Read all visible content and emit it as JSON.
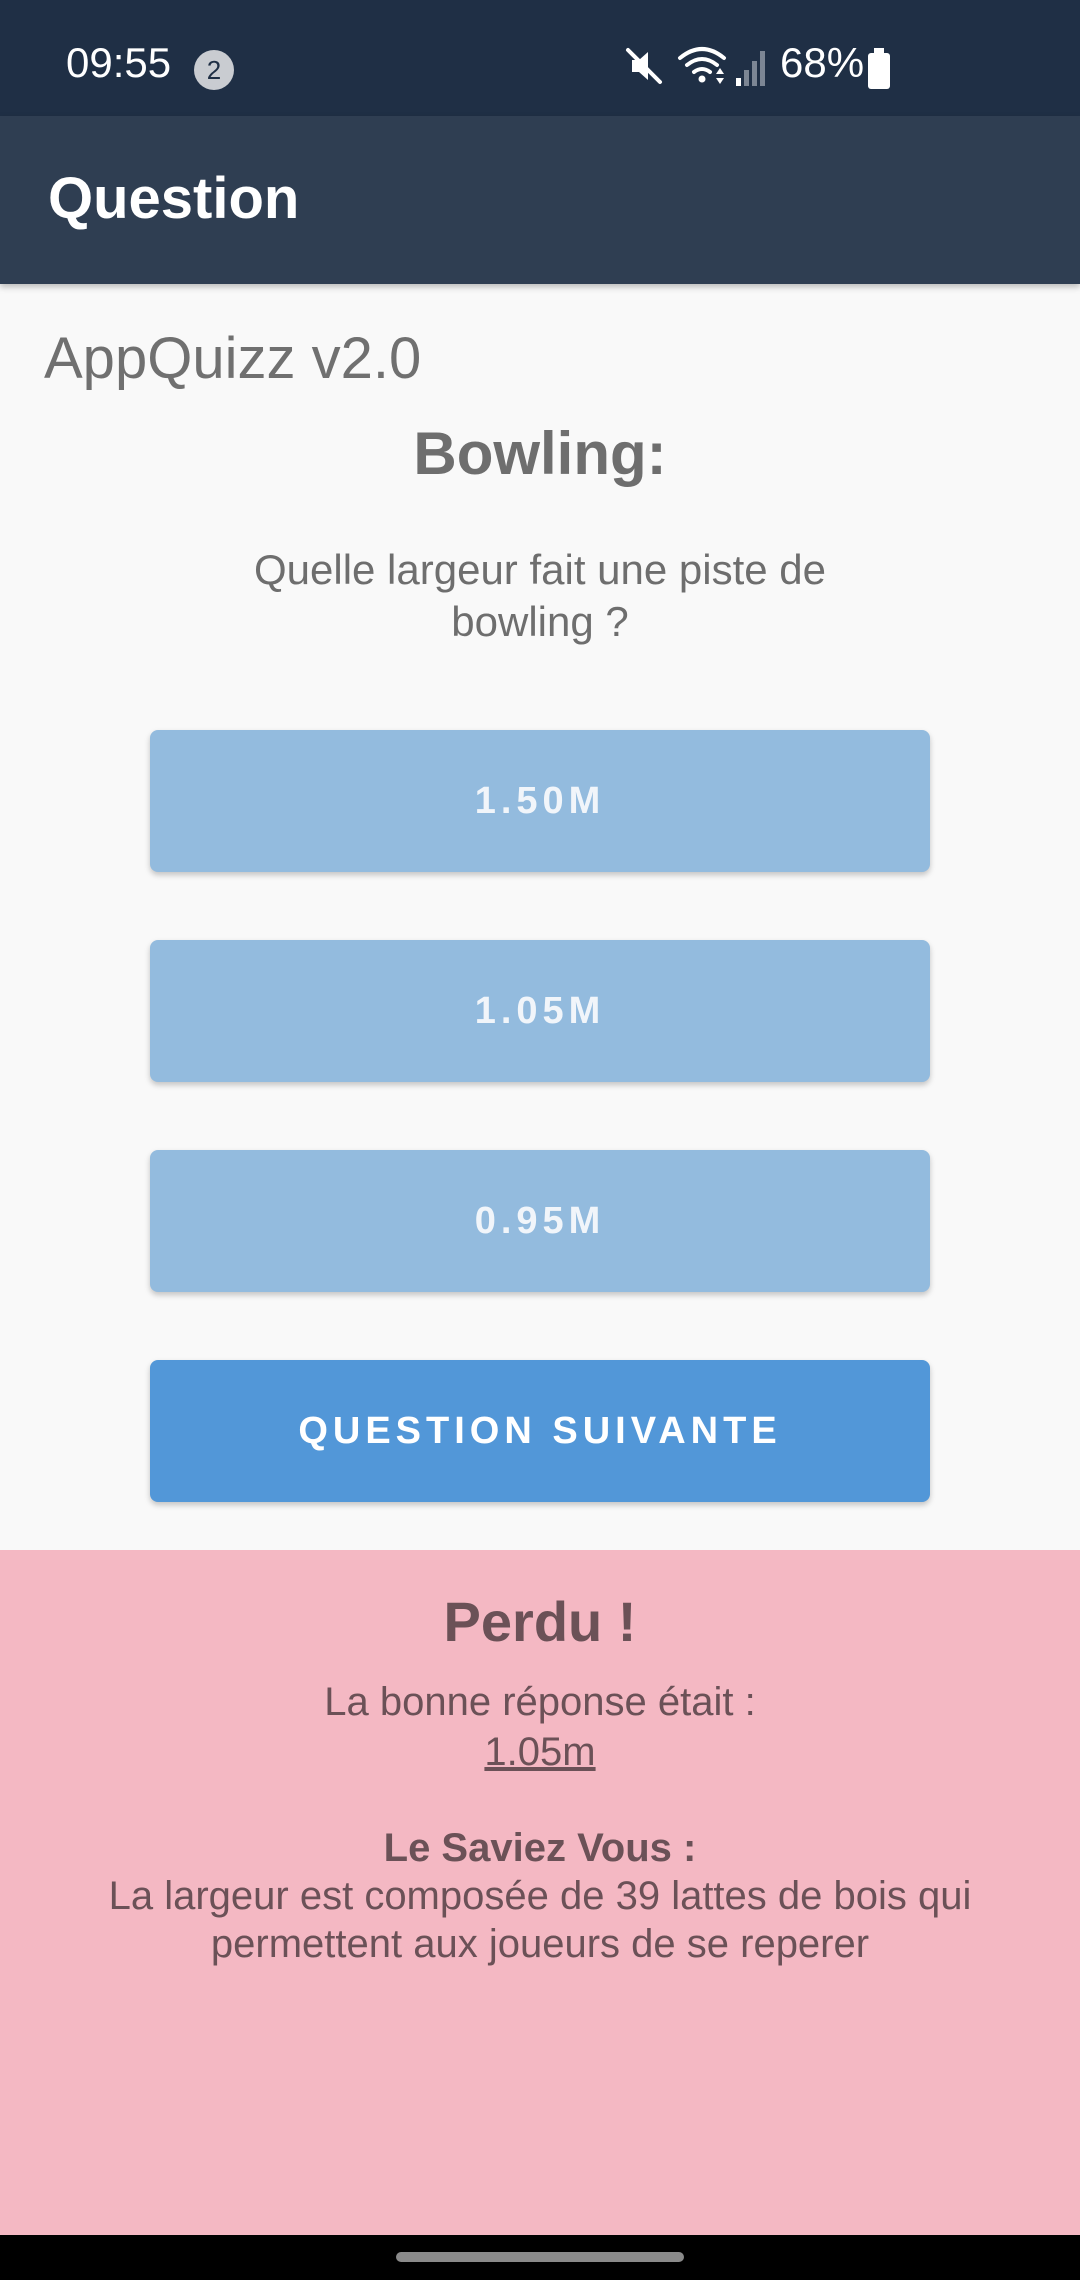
{
  "status_bar": {
    "time": "09:55",
    "notification_count": "2",
    "battery": "68%",
    "icons": [
      "mute-icon",
      "wifi-icon",
      "signal-icon",
      "battery-icon"
    ]
  },
  "app_bar": {
    "title": "Question"
  },
  "content": {
    "app_version": "AppQuizz v2.0",
    "category": "Bowling:",
    "question": "Quelle largeur fait une piste de bowling ?",
    "answers": [
      {
        "label": "1.50M"
      },
      {
        "label": "1.05M"
      },
      {
        "label": "0.95M"
      }
    ],
    "next_button": "QUESTION SUIVANTE"
  },
  "result": {
    "title": "Perdu !",
    "correct_answer_prefix": "La bonne réponse était :",
    "correct_answer": "1.05m",
    "fact_title": "Le Saviez Vous :",
    "fact_text": "La largeur est composée de 39 lattes de bois qui permettent aux joueurs de se reperer"
  },
  "colors": {
    "status_bar_bg": "#1f2f45",
    "app_bar_bg": "#2f3e52",
    "answer_button_bg": "#93bbde",
    "next_button_bg": "#5297d8",
    "result_panel_bg": "#f4b8c3"
  }
}
